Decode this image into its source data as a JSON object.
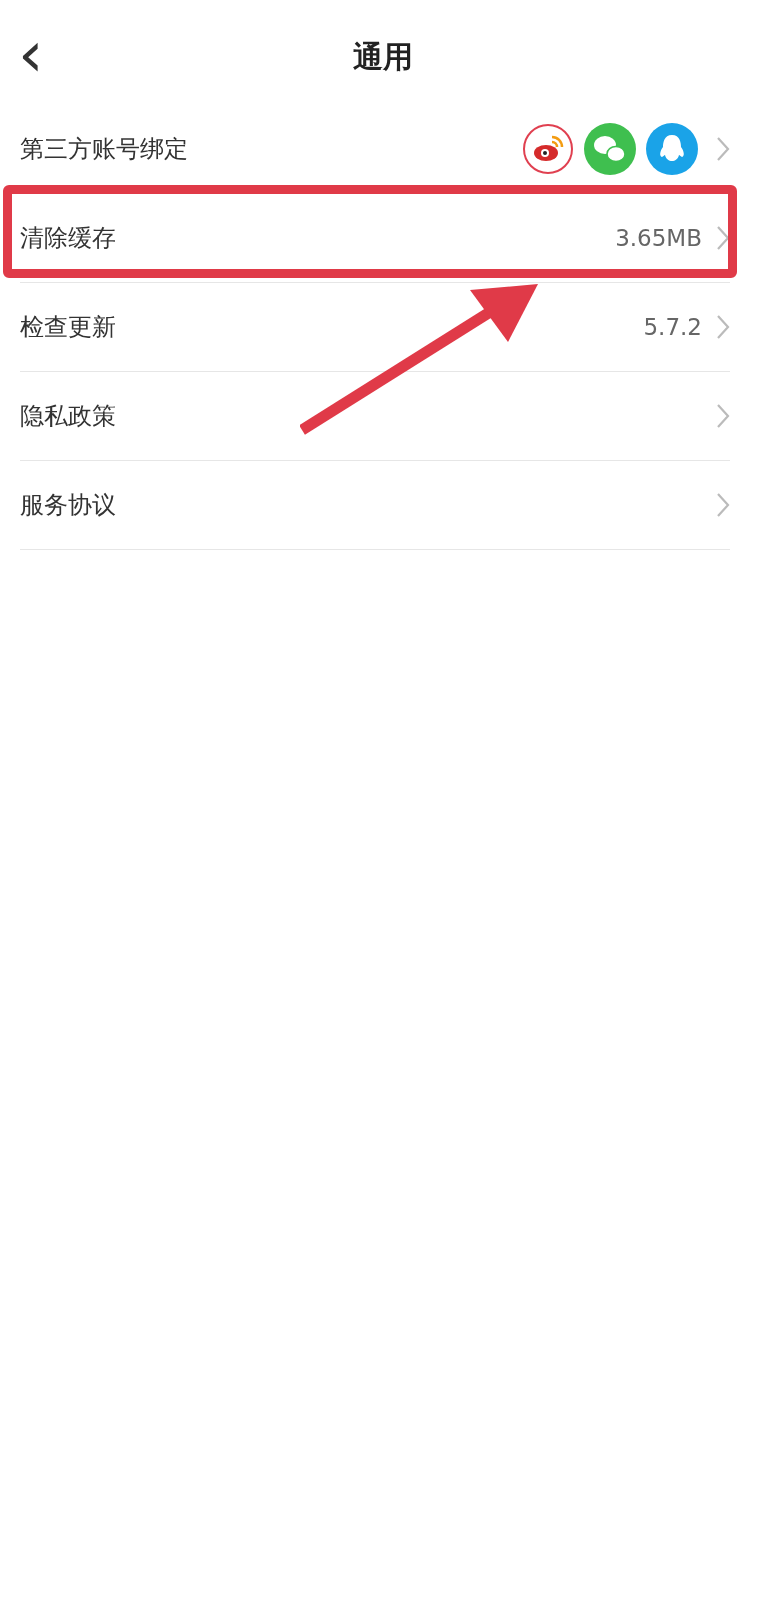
{
  "header": {
    "back": "‹",
    "title": "通用"
  },
  "rows": [
    {
      "kind": "accounts",
      "label": "第三方账号绑定",
      "annotated": false
    },
    {
      "kind": "value",
      "label": "清除缓存",
      "value": "3.65MB",
      "annotated": true
    },
    {
      "kind": "value",
      "label": "检查更新",
      "value": "5.7.2",
      "annotated": false
    },
    {
      "kind": "plain",
      "label": "隐私政策",
      "annotated": false
    },
    {
      "kind": "plain",
      "label": "服务协议",
      "annotated": false
    }
  ]
}
